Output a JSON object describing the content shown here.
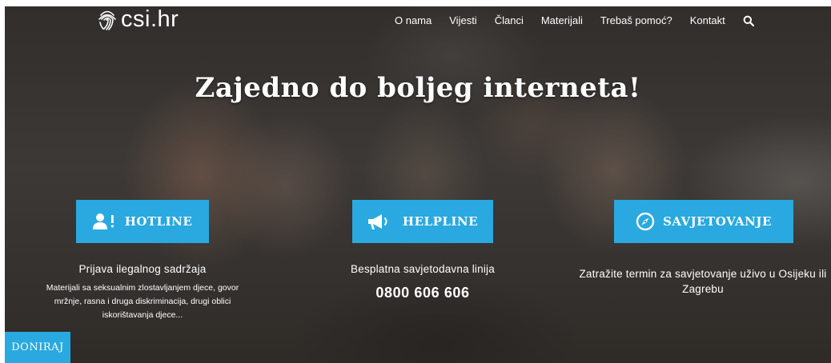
{
  "logo": {
    "text": "csi.hr",
    "icon": "fingerprint-logo-icon"
  },
  "nav": {
    "items": [
      "O nama",
      "Vijesti",
      "Članci",
      "Materijali",
      "Trebaš pomoć?",
      "Kontakt"
    ],
    "search_icon": "search-icon"
  },
  "hero": {
    "headline": "Zajedno do boljeg interneta!"
  },
  "columns": [
    {
      "button_label": "HOTLINE",
      "icon": "user-alert-icon",
      "lead": "Prijava ilegalnog sadržaja",
      "description": "Materijali sa seksualnim zlostavljanjem djece, govor mržnje, rasna i druga diskriminacija, drugi oblici iskorištavanja djece..."
    },
    {
      "button_label": "HELPLINE",
      "icon": "megaphone-icon",
      "lead": "Besplatna savjetodavna linija",
      "phone": "0800 606 606"
    },
    {
      "button_label": "SAVJETOVANJE",
      "icon": "compass-icon",
      "lead": "Zatražite termin za savjetovanje uživo u Osijeku ili Zagrebu"
    }
  ],
  "donate": {
    "label": "DONIRAJ"
  },
  "colors": {
    "accent": "#29a9e0",
    "text": "#ffffff"
  }
}
